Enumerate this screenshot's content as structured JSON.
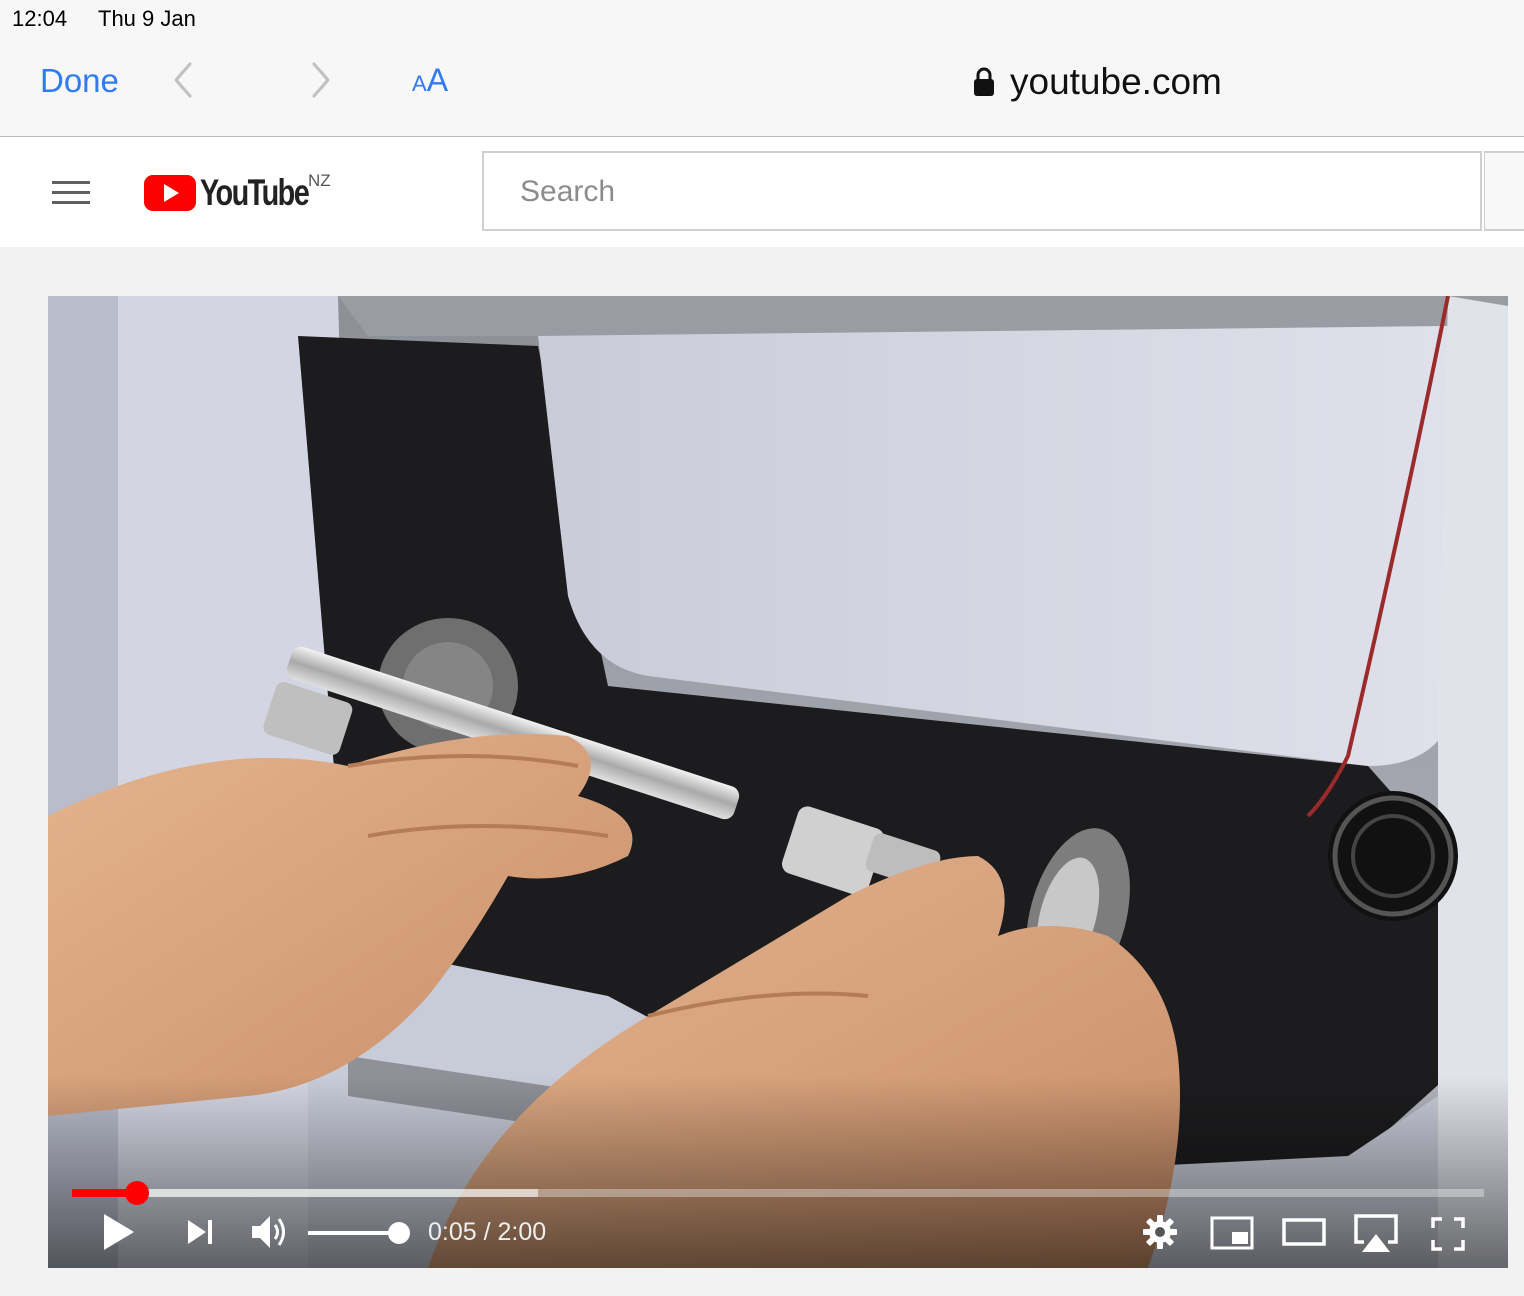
{
  "status_bar": {
    "time": "12:04",
    "date": "Thu 9 Jan"
  },
  "safari": {
    "done_label": "Done",
    "text_size_small": "A",
    "text_size_big": "A",
    "domain": "youtube.com"
  },
  "youtube": {
    "logo_text": "YouTube",
    "region": "NZ",
    "search": {
      "placeholder": "Search",
      "value": ""
    }
  },
  "player": {
    "current_time": "0:05",
    "duration": "2:00",
    "time_separator": " / ",
    "played_fraction": 0.046,
    "buffered_fraction": 0.33,
    "volume_fraction": 1.0
  },
  "colors": {
    "accent_blue": "#2f7bf0",
    "youtube_red": "#ff0000"
  }
}
